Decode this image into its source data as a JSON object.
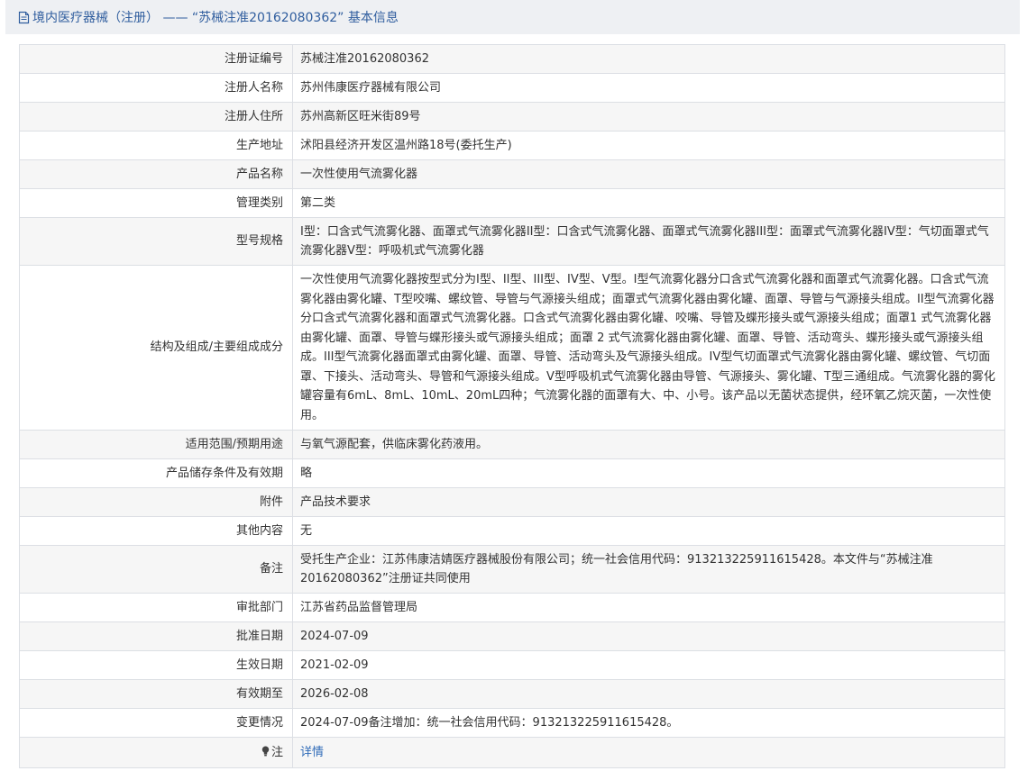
{
  "header": {
    "title": "境内医疗器械（注册） ——  “苏械注准20162080362” 基本信息",
    "icon": "document-icon"
  },
  "rows": [
    {
      "label": "注册证编号",
      "value": "苏械注准20162080362"
    },
    {
      "label": "注册人名称",
      "value": "苏州伟康医疗器械有限公司"
    },
    {
      "label": "注册人住所",
      "value": "苏州高新区旺米街89号"
    },
    {
      "label": "生产地址",
      "value": "沭阳县经济开发区温州路18号(委托生产)"
    },
    {
      "label": "产品名称",
      "value": "一次性使用气流雾化器"
    },
    {
      "label": "管理类别",
      "value": "第二类"
    },
    {
      "label": "型号规格",
      "value": "I型：口含式气流雾化器、面罩式气流雾化器II型：口含式气流雾化器、面罩式气流雾化器III型：面罩式气流雾化器IV型：气切面罩式气流雾化器Ⅴ型：呼吸机式气流雾化器"
    },
    {
      "label": "结构及组成/主要组成成分",
      "value": "一次性使用气流雾化器按型式分为I型、II型、III型、IV型、Ⅴ型。I型气流雾化器分口含式气流雾化器和面罩式气流雾化器。口含式气流雾化器由雾化罐、T型咬嘴、螺纹管、导管与气源接头组成；面罩式气流雾化器由雾化罐、面罩、导管与气源接头组成。II型气流雾化器分口含式气流雾化器和面罩式气流雾化器。口含式气流雾化器由雾化罐、咬嘴、导管及蝶形接头或气源接头组成；面罩1 式气流雾化器由雾化罐、面罩、导管与蝶形接头或气源接头组成；面罩 2 式气流雾化器由雾化罐、面罩、导管、活动弯头、蝶形接头或气源接头组成。III型气流雾化器面罩式由雾化罐、面罩、导管、活动弯头及气源接头组成。IV型气切面罩式气流雾化器由雾化罐、螺纹管、气切面罩、下接头、活动弯头、导管和气源接头组成。Ⅴ型呼吸机式气流雾化器由导管、气源接头、雾化罐、T型三通组成。气流雾化器的雾化罐容量有6mL、8mL、10mL、20mL四种；气流雾化器的面罩有大、中、小号。该产品以无菌状态提供，经环氧乙烷灭菌，一次性使用。"
    },
    {
      "label": "适用范围/预期用途",
      "value": "与氧气源配套，供临床雾化药液用。"
    },
    {
      "label": "产品储存条件及有效期",
      "value": "略"
    },
    {
      "label": "附件",
      "value": "产品技术要求"
    },
    {
      "label": "其他内容",
      "value": "无"
    },
    {
      "label": "备注",
      "value": "受托生产企业：江苏伟康洁婧医疗器械股份有限公司；统一社会信用代码：913213225911615428。本文件与“苏械注准20162080362”注册证共同使用"
    },
    {
      "label": "审批部门",
      "value": "江苏省药品监督管理局"
    },
    {
      "label": "批准日期",
      "value": "2024-07-09"
    },
    {
      "label": "生效日期",
      "value": "2021-02-09"
    },
    {
      "label": "有效期至",
      "value": "2026-02-08"
    },
    {
      "label": "变更情况",
      "value": "2024-07-09备注增加：统一社会信用代码：913213225911615428。"
    }
  ],
  "note_row": {
    "label": "注",
    "icon": "lightbulb-icon",
    "link": "详情"
  }
}
